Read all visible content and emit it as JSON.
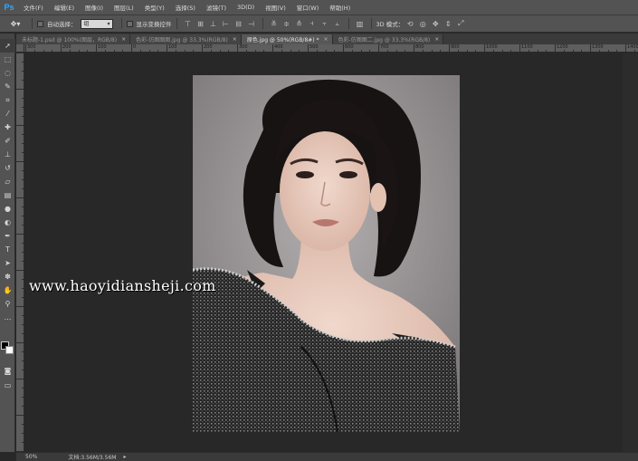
{
  "app": {
    "logo": "Ps"
  },
  "menu": [
    "文件(F)",
    "编辑(E)",
    "图像(I)",
    "图层(L)",
    "类型(Y)",
    "选择(S)",
    "滤镜(T)",
    "3D(D)",
    "视图(V)",
    "窗口(W)",
    "帮助(H)"
  ],
  "options": {
    "auto_select_label": "自动选择：",
    "auto_select_value": "组",
    "show_transform_label": "显示变换控件",
    "mode_3d_label": "3D 模式："
  },
  "tabs": [
    {
      "label": "未标题-1.psd @ 100%(图层，RGB/8)",
      "active": false
    },
    {
      "label": "色彩-仿图图图.jpg @ 33.3%(RGB/8)",
      "active": false
    },
    {
      "label": "原色.jpg @ 50%(RGB/8#) *",
      "active": true
    },
    {
      "label": "色彩-仿图图二.jpg @ 33.3%(RGB/8)",
      "active": false
    }
  ],
  "ruler": {
    "top_labels": [
      "300",
      "200",
      "100",
      "0",
      "100",
      "200",
      "300",
      "400",
      "500",
      "600",
      "700",
      "800",
      "900",
      "1000",
      "1100",
      "1200",
      "1300",
      "1400"
    ]
  },
  "watermark": "www.haoyidiansheji.com",
  "status": {
    "zoom": "50%",
    "doc_info": "文档:3.56M/3.56M"
  },
  "colors": {
    "foreground": "#000000",
    "background": "#ffffff",
    "chrome": "#535353",
    "workspace": "#282828"
  },
  "icons": {
    "tools": [
      "move-icon",
      "marquee-icon",
      "lasso-icon",
      "quick-select-icon",
      "crop-icon",
      "eyedropper-icon",
      "healing-brush-icon",
      "brush-icon",
      "clone-stamp-icon",
      "history-brush-icon",
      "eraser-icon",
      "gradient-icon",
      "blur-icon",
      "dodge-icon",
      "pen-icon",
      "type-icon",
      "path-select-icon",
      "shape-icon",
      "hand-icon",
      "zoom-icon"
    ]
  }
}
